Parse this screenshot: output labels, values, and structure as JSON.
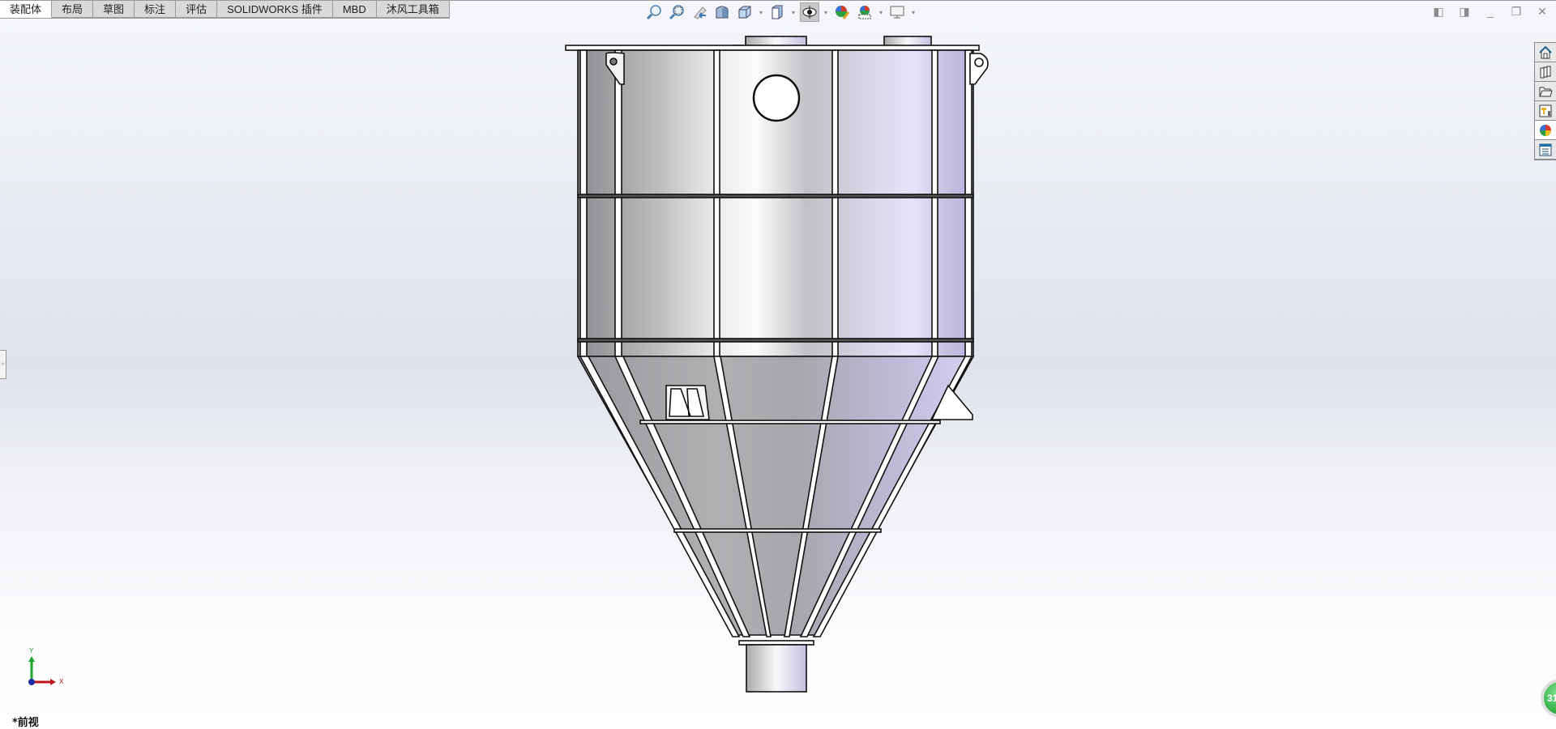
{
  "tabs": [
    {
      "label": "装配体",
      "active": true
    },
    {
      "label": "布局"
    },
    {
      "label": "草图"
    },
    {
      "label": "标注"
    },
    {
      "label": "评估"
    },
    {
      "label": "SOLIDWORKS 插件"
    },
    {
      "label": "MBD"
    },
    {
      "label": "沐风工具箱"
    }
  ],
  "heads_up_toolbar": [
    "zoom-to-fit-icon",
    "zoom-to-area-icon",
    "previous-view-icon",
    "section-view-icon",
    "view-orientation-icon",
    "display-style-icon",
    "hide-show-items-icon",
    "edit-appearance-icon",
    "apply-scene-icon",
    "view-settings-icon"
  ],
  "window_controls": [
    "tile-left-icon",
    "tile-right-icon",
    "minimize-icon",
    "restore-icon",
    "close-icon"
  ],
  "task_pane": [
    "home-icon",
    "design-library-icon",
    "file-explorer-icon",
    "view-palette-icon",
    "appearances-icon",
    "custom-properties-icon"
  ],
  "triad": {
    "x_label": "X",
    "y_label": "Y"
  },
  "view_label": "*前视",
  "badge_count": "31",
  "colors": {
    "x_axis": "#c0161b",
    "y_axis": "#1ea52e",
    "origin": "#1c2fa0",
    "badge": "#35b34a"
  }
}
